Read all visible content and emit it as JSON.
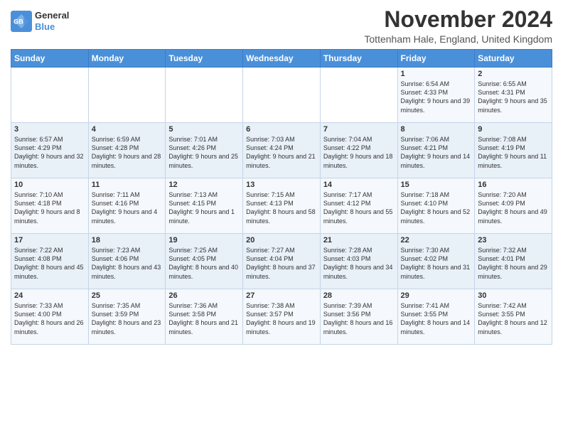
{
  "header": {
    "logo_line1": "General",
    "logo_line2": "Blue",
    "month_title": "November 2024",
    "location": "Tottenham Hale, England, United Kingdom"
  },
  "days_of_week": [
    "Sunday",
    "Monday",
    "Tuesday",
    "Wednesday",
    "Thursday",
    "Friday",
    "Saturday"
  ],
  "weeks": [
    [
      {
        "day": "",
        "info": ""
      },
      {
        "day": "",
        "info": ""
      },
      {
        "day": "",
        "info": ""
      },
      {
        "day": "",
        "info": ""
      },
      {
        "day": "",
        "info": ""
      },
      {
        "day": "1",
        "info": "Sunrise: 6:54 AM\nSunset: 4:33 PM\nDaylight: 9 hours and 39 minutes."
      },
      {
        "day": "2",
        "info": "Sunrise: 6:55 AM\nSunset: 4:31 PM\nDaylight: 9 hours and 35 minutes."
      }
    ],
    [
      {
        "day": "3",
        "info": "Sunrise: 6:57 AM\nSunset: 4:29 PM\nDaylight: 9 hours and 32 minutes."
      },
      {
        "day": "4",
        "info": "Sunrise: 6:59 AM\nSunset: 4:28 PM\nDaylight: 9 hours and 28 minutes."
      },
      {
        "day": "5",
        "info": "Sunrise: 7:01 AM\nSunset: 4:26 PM\nDaylight: 9 hours and 25 minutes."
      },
      {
        "day": "6",
        "info": "Sunrise: 7:03 AM\nSunset: 4:24 PM\nDaylight: 9 hours and 21 minutes."
      },
      {
        "day": "7",
        "info": "Sunrise: 7:04 AM\nSunset: 4:22 PM\nDaylight: 9 hours and 18 minutes."
      },
      {
        "day": "8",
        "info": "Sunrise: 7:06 AM\nSunset: 4:21 PM\nDaylight: 9 hours and 14 minutes."
      },
      {
        "day": "9",
        "info": "Sunrise: 7:08 AM\nSunset: 4:19 PM\nDaylight: 9 hours and 11 minutes."
      }
    ],
    [
      {
        "day": "10",
        "info": "Sunrise: 7:10 AM\nSunset: 4:18 PM\nDaylight: 9 hours and 8 minutes."
      },
      {
        "day": "11",
        "info": "Sunrise: 7:11 AM\nSunset: 4:16 PM\nDaylight: 9 hours and 4 minutes."
      },
      {
        "day": "12",
        "info": "Sunrise: 7:13 AM\nSunset: 4:15 PM\nDaylight: 9 hours and 1 minute."
      },
      {
        "day": "13",
        "info": "Sunrise: 7:15 AM\nSunset: 4:13 PM\nDaylight: 8 hours and 58 minutes."
      },
      {
        "day": "14",
        "info": "Sunrise: 7:17 AM\nSunset: 4:12 PM\nDaylight: 8 hours and 55 minutes."
      },
      {
        "day": "15",
        "info": "Sunrise: 7:18 AM\nSunset: 4:10 PM\nDaylight: 8 hours and 52 minutes."
      },
      {
        "day": "16",
        "info": "Sunrise: 7:20 AM\nSunset: 4:09 PM\nDaylight: 8 hours and 49 minutes."
      }
    ],
    [
      {
        "day": "17",
        "info": "Sunrise: 7:22 AM\nSunset: 4:08 PM\nDaylight: 8 hours and 45 minutes."
      },
      {
        "day": "18",
        "info": "Sunrise: 7:23 AM\nSunset: 4:06 PM\nDaylight: 8 hours and 43 minutes."
      },
      {
        "day": "19",
        "info": "Sunrise: 7:25 AM\nSunset: 4:05 PM\nDaylight: 8 hours and 40 minutes."
      },
      {
        "day": "20",
        "info": "Sunrise: 7:27 AM\nSunset: 4:04 PM\nDaylight: 8 hours and 37 minutes."
      },
      {
        "day": "21",
        "info": "Sunrise: 7:28 AM\nSunset: 4:03 PM\nDaylight: 8 hours and 34 minutes."
      },
      {
        "day": "22",
        "info": "Sunrise: 7:30 AM\nSunset: 4:02 PM\nDaylight: 8 hours and 31 minutes."
      },
      {
        "day": "23",
        "info": "Sunrise: 7:32 AM\nSunset: 4:01 PM\nDaylight: 8 hours and 29 minutes."
      }
    ],
    [
      {
        "day": "24",
        "info": "Sunrise: 7:33 AM\nSunset: 4:00 PM\nDaylight: 8 hours and 26 minutes."
      },
      {
        "day": "25",
        "info": "Sunrise: 7:35 AM\nSunset: 3:59 PM\nDaylight: 8 hours and 23 minutes."
      },
      {
        "day": "26",
        "info": "Sunrise: 7:36 AM\nSunset: 3:58 PM\nDaylight: 8 hours and 21 minutes."
      },
      {
        "day": "27",
        "info": "Sunrise: 7:38 AM\nSunset: 3:57 PM\nDaylight: 8 hours and 19 minutes."
      },
      {
        "day": "28",
        "info": "Sunrise: 7:39 AM\nSunset: 3:56 PM\nDaylight: 8 hours and 16 minutes."
      },
      {
        "day": "29",
        "info": "Sunrise: 7:41 AM\nSunset: 3:55 PM\nDaylight: 8 hours and 14 minutes."
      },
      {
        "day": "30",
        "info": "Sunrise: 7:42 AM\nSunset: 3:55 PM\nDaylight: 8 hours and 12 minutes."
      }
    ]
  ]
}
